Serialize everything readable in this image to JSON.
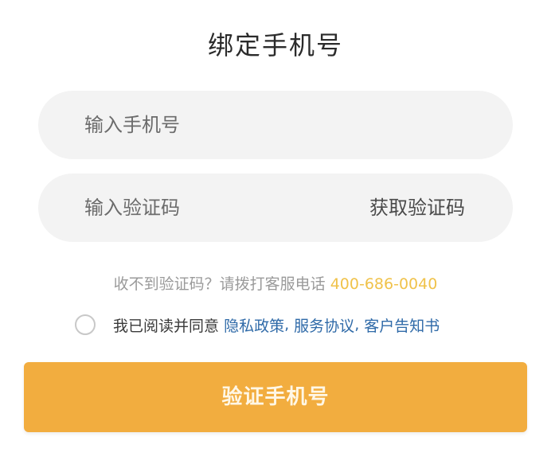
{
  "title": "绑定手机号",
  "phone_field": {
    "placeholder": "输入手机号",
    "value": ""
  },
  "code_field": {
    "placeholder": "输入验证码",
    "value": "",
    "get_code_label": "获取验证码"
  },
  "help": {
    "text": "收不到验证码？请拨打客服电话",
    "phone": "400-686-0040"
  },
  "agreement": {
    "checked": false,
    "prefix": "我已阅读并同意",
    "links": [
      "隐私政策",
      "服务协议",
      "客户告知书"
    ],
    "separator": ","
  },
  "submit_label": "验证手机号",
  "colors": {
    "accent": "#f2ad3f",
    "phone_highlight": "#f0c24a",
    "link": "#2f6aa8"
  }
}
